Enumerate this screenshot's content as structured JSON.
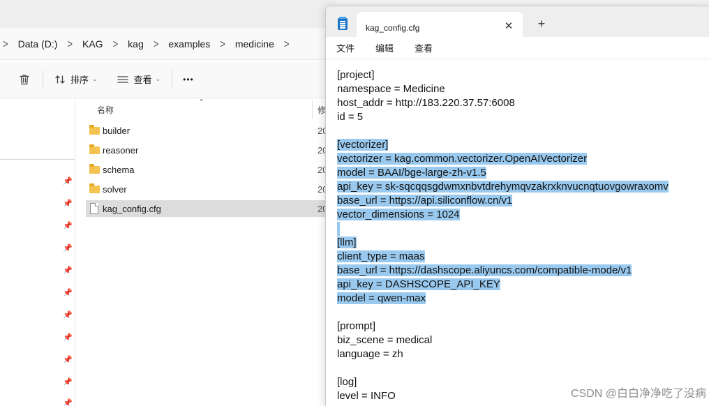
{
  "explorer": {
    "breadcrumb": [
      "Data (D:)",
      "KAG",
      "kag",
      "examples",
      "medicine"
    ],
    "toolbar": {
      "sort_label": "排序",
      "view_label": "查看",
      "more_label": "•••"
    },
    "columns": {
      "name": "名称",
      "modified": "修"
    },
    "files": [
      {
        "name": "builder",
        "type": "folder",
        "date": "20"
      },
      {
        "name": "reasoner",
        "type": "folder",
        "date": "20"
      },
      {
        "name": "schema",
        "type": "folder",
        "date": "20"
      },
      {
        "name": "solver",
        "type": "folder",
        "date": "20"
      },
      {
        "name": "kag_config.cfg",
        "type": "file",
        "date": "20",
        "selected": true
      }
    ]
  },
  "notepad": {
    "tab_title": "kag_config.cfg",
    "menu": [
      "文件",
      "编辑",
      "查看"
    ],
    "lines": [
      {
        "text": "[project]",
        "selected": false
      },
      {
        "text": "namespace = Medicine",
        "selected": false
      },
      {
        "text": "host_addr = http://183.220.37.57:6008",
        "selected": false
      },
      {
        "text": "id = 5",
        "selected": false
      },
      {
        "text": "",
        "selected": false
      },
      {
        "text": "[vectorizer]",
        "selected": true
      },
      {
        "text": "vectorizer = kag.common.vectorizer.OpenAIVectorizer",
        "selected": true
      },
      {
        "text": "model = BAAI/bge-large-zh-v1.5",
        "selected": true
      },
      {
        "text": "api_key = sk-sqcqqsgdwmxnbvtdrehymqvzakrxknvucnqtuovgowraxomv",
        "selected": true
      },
      {
        "text": "base_url = https://api.siliconflow.cn/v1",
        "selected": true
      },
      {
        "text": "vector_dimensions = 1024",
        "selected": true
      },
      {
        "text": "",
        "selected": true
      },
      {
        "text": "[llm]",
        "selected": true
      },
      {
        "text": "client_type = maas",
        "selected": true
      },
      {
        "text": "base_url = https://dashscope.aliyuncs.com/compatible-mode/v1",
        "selected": true
      },
      {
        "text": "api_key = DASHSCOPE_API_KEY",
        "selected": true
      },
      {
        "text": "model = qwen-max",
        "selected": true
      },
      {
        "text": "",
        "selected": false
      },
      {
        "text": "[prompt]",
        "selected": false
      },
      {
        "text": "biz_scene = medical",
        "selected": false
      },
      {
        "text": "language = zh",
        "selected": false
      },
      {
        "text": "",
        "selected": false
      },
      {
        "text": "[log]",
        "selected": false
      },
      {
        "text": "level = INFO",
        "selected": false
      }
    ]
  },
  "watermark": "CSDN @白白净净吃了没病",
  "colors": {
    "selection": "#99c9ee",
    "folder": "#f4c24e",
    "notepad_icon": "#1e74c7"
  }
}
